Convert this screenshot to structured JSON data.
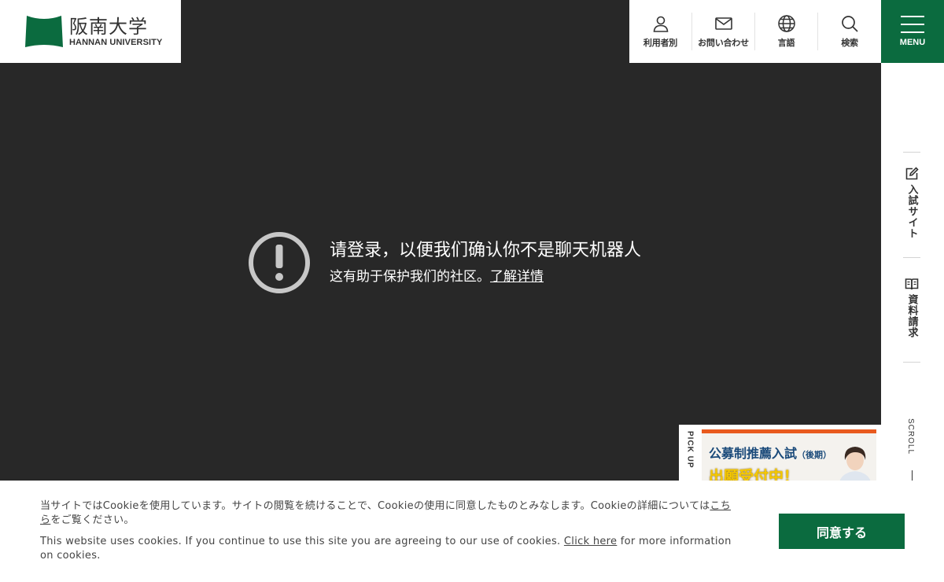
{
  "logo": {
    "name_jp": "阪南大学",
    "name_en": "HANNAN UNIVERSITY",
    "brand_color": "#0b6b3f"
  },
  "header": {
    "nav": [
      {
        "label": "利用者別",
        "icon": "person-icon"
      },
      {
        "label": "お問い合わせ",
        "icon": "mail-icon"
      },
      {
        "label": "言語",
        "icon": "globe-icon"
      },
      {
        "label": "検索",
        "icon": "search-icon"
      }
    ],
    "menu_label": "MENU"
  },
  "sidebar": {
    "links": [
      {
        "label": "入試サイト",
        "icon": "edit-icon"
      },
      {
        "label": "資料請求",
        "icon": "book-icon"
      }
    ],
    "scroll_label": "SCROLL"
  },
  "error": {
    "title": "请登录，以便我们确认你不是聊天机器人",
    "subtitle": "这有助于保护我们的社区。",
    "link": "了解详情"
  },
  "pickup": {
    "label": "PICK UP",
    "banner_title": "公募制推薦入試",
    "banner_title_small": "（後期）",
    "banner_sub": "出願受付中！"
  },
  "cookie": {
    "jp_text": "当サイトではCookieを使用しています。サイトの閲覧を続けることで、Cookieの使用に同意したものとみなします。Cookieの詳細については",
    "jp_link": "こちら",
    "jp_tail": "をご覧ください。",
    "en_text": "This website uses cookies. If you continue to use this site you are agreeing to our use of cookies. ",
    "en_link": "Click here",
    "en_tail": " for more information on cookies.",
    "agree_label": "同意する"
  },
  "colors": {
    "hero_bg": "#282828",
    "accent_green": "#0b6b3f",
    "banner_orange": "#e95a1e"
  }
}
